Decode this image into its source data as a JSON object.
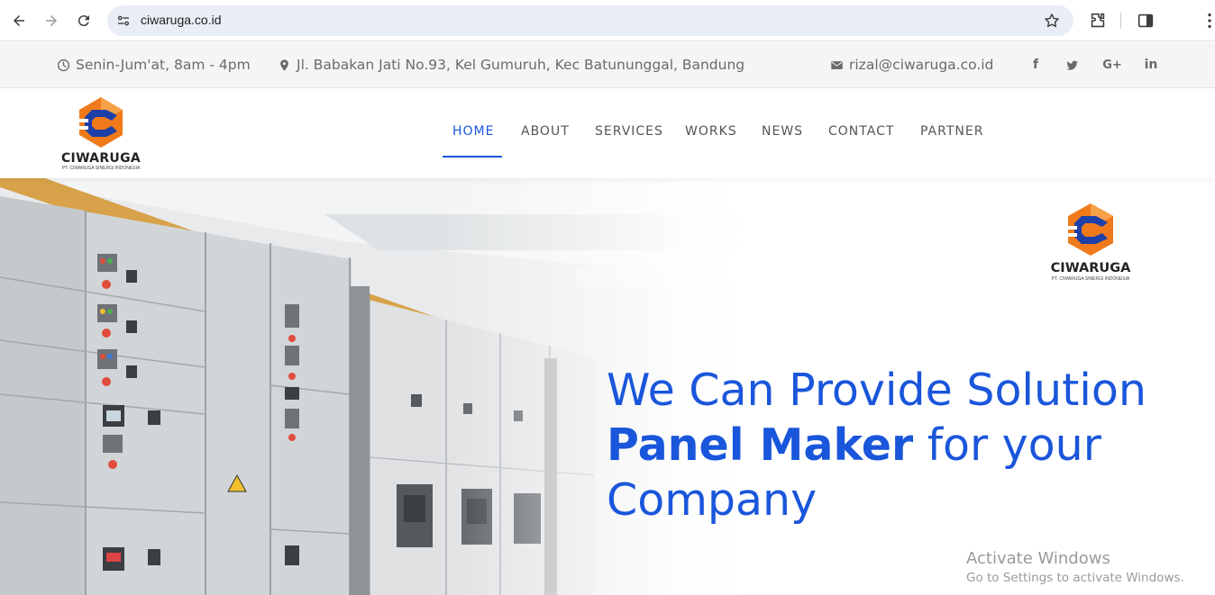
{
  "browser": {
    "url": "ciwaruga.co.id",
    "icons": [
      "back-arrow-icon",
      "forward-arrow-icon",
      "reload-icon",
      "site-info-icon",
      "star-icon",
      "extensions-icon",
      "side-panel-icon",
      "more-vert-icon"
    ]
  },
  "topbar": {
    "hours": "Senin-Jum'at, 8am - 4pm",
    "address": "Jl. Babakan Jati No.93, Kel Gumuruh, Kec Batununggal, Bandung",
    "email": "rizal@ciwaruga.co.id",
    "social": [
      {
        "name": "facebook-icon",
        "glyph": "f"
      },
      {
        "name": "twitter-icon",
        "glyph": "t"
      },
      {
        "name": "google-plus-icon",
        "glyph": "G+"
      },
      {
        "name": "linkedin-icon",
        "glyph": "in"
      }
    ]
  },
  "header": {
    "logo_text": "CIWARUGA",
    "logo_sub": "PT. CIWARUGA SINERGI INDONESIA",
    "menu": [
      {
        "label": "HOME",
        "active": true
      },
      {
        "label": "ABOUT",
        "active": false
      },
      {
        "label": "SERVICES",
        "active": false
      },
      {
        "label": "WORKS",
        "active": false
      },
      {
        "label": "NEWS",
        "active": false
      },
      {
        "label": "CONTACT",
        "active": false
      },
      {
        "label": "PARTNER",
        "active": false
      }
    ]
  },
  "hero": {
    "logo_text": "CIWARUGA",
    "logo_sub": "PT. CIWARUGA SINERGI INDONESIA",
    "line1": "We Can Provide Solution",
    "line2_bold": "Panel Maker",
    "line2_rest": " for your",
    "line3": "Company"
  },
  "watermark": {
    "title": "Activate Windows",
    "subtitle": "Go to Settings to activate Windows."
  },
  "colors": {
    "accent": "#1a56db",
    "logo_orange": "#f07a1a",
    "logo_blue": "#1e3fa8"
  }
}
